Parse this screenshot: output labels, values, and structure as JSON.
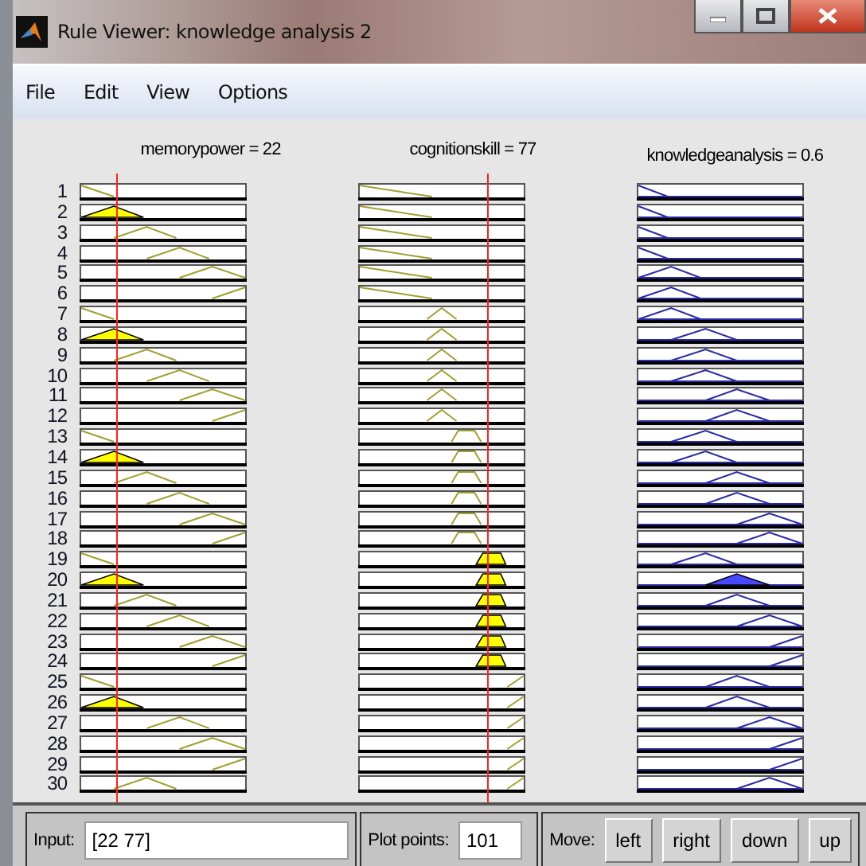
{
  "window": {
    "title": "Rule Viewer: knowledge analysis 2"
  },
  "menu": [
    "File",
    "Edit",
    "View",
    "Options"
  ],
  "variables": [
    {
      "label": "memorypower = 22",
      "kind": "input"
    },
    {
      "label": "cognitionskill = 77",
      "kind": "input"
    },
    {
      "label": "knowledgeanalysis = 0.6",
      "kind": "output"
    }
  ],
  "rules": [
    {
      "number": "1",
      "cells": [
        {
          "kind": "mf1",
          "active": false
        },
        {
          "kind": "mf1",
          "active": false
        },
        {
          "kind": "mf1",
          "active": false
        }
      ]
    },
    {
      "number": "2",
      "cells": [
        {
          "kind": "mf2",
          "active": true
        },
        {
          "kind": "mf1",
          "active": false
        },
        {
          "kind": "mf1",
          "active": false
        }
      ]
    },
    {
      "number": "3",
      "cells": [
        {
          "kind": "mf3",
          "active": false
        },
        {
          "kind": "mf1",
          "active": false
        },
        {
          "kind": "mf1",
          "active": false
        }
      ]
    },
    {
      "number": "4",
      "cells": [
        {
          "kind": "mf4",
          "active": false
        },
        {
          "kind": "mf1",
          "active": false
        },
        {
          "kind": "mf1",
          "active": false
        }
      ]
    },
    {
      "number": "5",
      "cells": [
        {
          "kind": "mf5",
          "active": false
        },
        {
          "kind": "mf1",
          "active": false
        },
        {
          "kind": "mf2",
          "active": false
        }
      ]
    },
    {
      "number": "6",
      "cells": [
        {
          "kind": "mf6",
          "active": false
        },
        {
          "kind": "mf1",
          "active": false
        },
        {
          "kind": "mf2",
          "active": false
        }
      ]
    },
    {
      "number": "7",
      "cells": [
        {
          "kind": "mf1",
          "active": false
        },
        {
          "kind": "mf2",
          "active": false
        },
        {
          "kind": "mf2",
          "active": false
        }
      ]
    },
    {
      "number": "8",
      "cells": [
        {
          "kind": "mf2",
          "active": true
        },
        {
          "kind": "mf2",
          "active": false
        },
        {
          "kind": "mf3",
          "active": false
        }
      ]
    },
    {
      "number": "9",
      "cells": [
        {
          "kind": "mf3",
          "active": false
        },
        {
          "kind": "mf2",
          "active": false
        },
        {
          "kind": "mf3",
          "active": false
        }
      ]
    },
    {
      "number": "10",
      "cells": [
        {
          "kind": "mf4",
          "active": false
        },
        {
          "kind": "mf2",
          "active": false
        },
        {
          "kind": "mf3",
          "active": false
        }
      ]
    },
    {
      "number": "11",
      "cells": [
        {
          "kind": "mf5",
          "active": false
        },
        {
          "kind": "mf2",
          "active": false
        },
        {
          "kind": "mf4",
          "active": false
        }
      ]
    },
    {
      "number": "12",
      "cells": [
        {
          "kind": "mf6",
          "active": false
        },
        {
          "kind": "mf2",
          "active": false
        },
        {
          "kind": "mf4",
          "active": false
        }
      ]
    },
    {
      "number": "13",
      "cells": [
        {
          "kind": "mf1",
          "active": false
        },
        {
          "kind": "mf3",
          "active": false
        },
        {
          "kind": "mf3",
          "active": false
        }
      ]
    },
    {
      "number": "14",
      "cells": [
        {
          "kind": "mf2",
          "active": true
        },
        {
          "kind": "mf3",
          "active": false
        },
        {
          "kind": "mf3",
          "active": false
        }
      ]
    },
    {
      "number": "15",
      "cells": [
        {
          "kind": "mf3",
          "active": false
        },
        {
          "kind": "mf3",
          "active": false
        },
        {
          "kind": "mf4",
          "active": false
        }
      ]
    },
    {
      "number": "16",
      "cells": [
        {
          "kind": "mf4",
          "active": false
        },
        {
          "kind": "mf3",
          "active": false
        },
        {
          "kind": "mf4",
          "active": false
        }
      ]
    },
    {
      "number": "17",
      "cells": [
        {
          "kind": "mf5",
          "active": false
        },
        {
          "kind": "mf3",
          "active": false
        },
        {
          "kind": "mf5",
          "active": false
        }
      ]
    },
    {
      "number": "18",
      "cells": [
        {
          "kind": "mf6",
          "active": false
        },
        {
          "kind": "mf3",
          "active": false
        },
        {
          "kind": "mf5",
          "active": false
        }
      ]
    },
    {
      "number": "19",
      "cells": [
        {
          "kind": "mf1",
          "active": false
        },
        {
          "kind": "mf4",
          "active": true
        },
        {
          "kind": "mf3",
          "active": false
        }
      ]
    },
    {
      "number": "20",
      "cells": [
        {
          "kind": "mf2",
          "active": true
        },
        {
          "kind": "mf4",
          "active": true
        },
        {
          "kind": "mf4",
          "active": true
        }
      ]
    },
    {
      "number": "21",
      "cells": [
        {
          "kind": "mf3",
          "active": false
        },
        {
          "kind": "mf4",
          "active": true
        },
        {
          "kind": "mf4",
          "active": false
        }
      ]
    },
    {
      "number": "22",
      "cells": [
        {
          "kind": "mf4",
          "active": false
        },
        {
          "kind": "mf4",
          "active": true
        },
        {
          "kind": "mf5",
          "active": false
        }
      ]
    },
    {
      "number": "23",
      "cells": [
        {
          "kind": "mf5",
          "active": false
        },
        {
          "kind": "mf4",
          "active": true
        },
        {
          "kind": "mf6",
          "active": false
        }
      ]
    },
    {
      "number": "24",
      "cells": [
        {
          "kind": "mf6",
          "active": false
        },
        {
          "kind": "mf4",
          "active": true
        },
        {
          "kind": "mf6",
          "active": false
        }
      ]
    },
    {
      "number": "25",
      "cells": [
        {
          "kind": "mf1",
          "active": false
        },
        {
          "kind": "mf5",
          "active": false
        },
        {
          "kind": "mf4",
          "active": false
        }
      ]
    },
    {
      "number": "26",
      "cells": [
        {
          "kind": "mf2",
          "active": true
        },
        {
          "kind": "mf5",
          "active": false
        },
        {
          "kind": "mf4",
          "active": false
        }
      ]
    },
    {
      "number": "27",
      "cells": [
        {
          "kind": "mf4",
          "active": false
        },
        {
          "kind": "mf5",
          "active": false
        },
        {
          "kind": "mf5",
          "active": false
        }
      ]
    },
    {
      "number": "28",
      "cells": [
        {
          "kind": "mf5",
          "active": false
        },
        {
          "kind": "mf5",
          "active": false
        },
        {
          "kind": "mf6",
          "active": false
        }
      ]
    },
    {
      "number": "29",
      "cells": [
        {
          "kind": "mf6",
          "active": false
        },
        {
          "kind": "mf5",
          "active": false
        },
        {
          "kind": "mf6",
          "active": false
        }
      ]
    },
    {
      "number": "30",
      "cells": [
        {
          "kind": "mf3",
          "active": false
        },
        {
          "kind": "mf5",
          "active": false
        },
        {
          "kind": "mf5",
          "active": false
        }
      ]
    }
  ],
  "input": {
    "label": "Input:",
    "value": "[22 77]"
  },
  "plot_points": {
    "label": "Plot points:",
    "value": "101"
  },
  "move": {
    "label": "Move:",
    "buttons": [
      "left",
      "right",
      "down",
      "up"
    ]
  }
}
